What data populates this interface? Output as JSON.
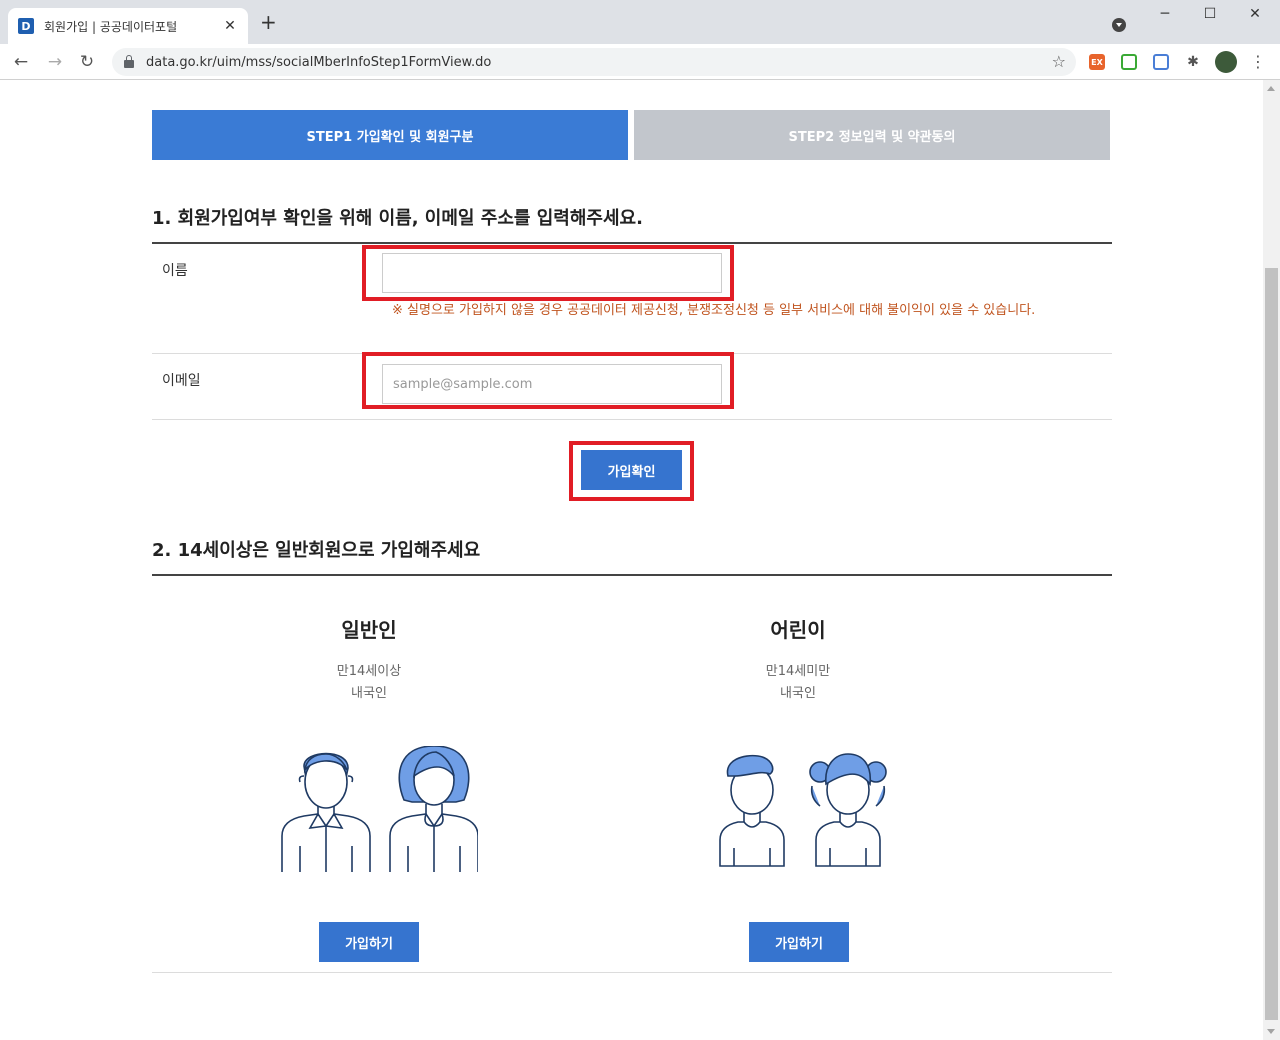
{
  "browser": {
    "tab_title": "회원가입 | 공공데이터포털",
    "favicon_letter": "D",
    "url": "data.go.kr/uim/mss/socialMberInfoStep1FormView.do"
  },
  "steps": [
    {
      "label": "STEP1  가입확인 및 회원구분",
      "active": true
    },
    {
      "label": "STEP2  정보입력 및 약관동의",
      "active": false
    }
  ],
  "section1": {
    "title": "1. 회원가입여부 확인을 위해 이름, 이메일 주소를 입력해주세요.",
    "name_label": "이름",
    "name_value": "",
    "name_notice": "※ 실명으로 가입하지 않을 경우 공공데이터 제공신청, 분쟁조정신청 등 일부 서비스에 대해 불이익이 있을 수 있습니다.",
    "email_label": "이메일",
    "email_value": "",
    "email_placeholder": "sample@sample.com",
    "confirm_button": "가입확인"
  },
  "section2": {
    "title": "2. 14세이상은 일반회원으로 가입해주세요",
    "adult": {
      "title": "일반인",
      "line1": "만14세이상",
      "line2": "내국인",
      "button": "가입하기"
    },
    "child": {
      "title": "어린이",
      "line1": "만14세미만",
      "line2": "내국인",
      "button": "가입하기"
    }
  },
  "colors": {
    "primary": "#3a7bd5",
    "inactive_step": "#c2c6cc",
    "highlight": "#e11d25",
    "notice": "#c0541f",
    "illustration_fill": "#6f9ee6",
    "illustration_stroke": "#1f3a63"
  }
}
